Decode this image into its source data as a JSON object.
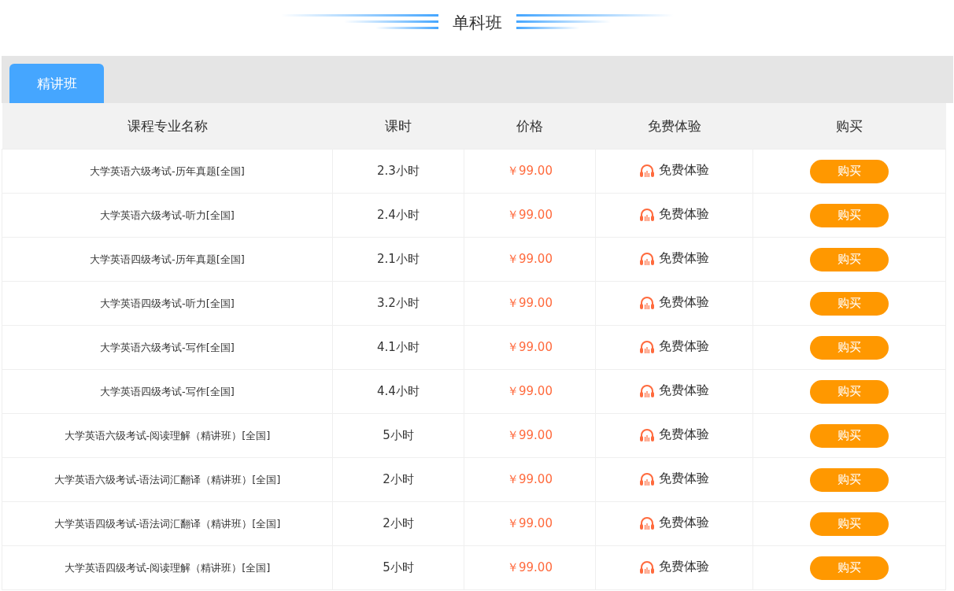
{
  "title": "单科班",
  "tabs": [
    {
      "label": "精讲班",
      "selected": true
    }
  ],
  "table": {
    "columns": [
      "课程专业名称",
      "课时",
      "价格",
      "免费体验",
      "购买"
    ],
    "rows": [
      {
        "name": "大学英语六级考试-历年真题[全国]",
        "hours": "2.3小时",
        "price": "￥99.00",
        "trial": "免费体验",
        "buy": "购买"
      },
      {
        "name": "大学英语六级考试-听力[全国]",
        "hours": "2.4小时",
        "price": "￥99.00",
        "trial": "免费体验",
        "buy": "购买"
      },
      {
        "name": "大学英语四级考试-历年真题[全国]",
        "hours": "2.1小时",
        "price": "￥99.00",
        "trial": "免费体验",
        "buy": "购买"
      },
      {
        "name": "大学英语四级考试-听力[全国]",
        "hours": "3.2小时",
        "price": "￥99.00",
        "trial": "免费体验",
        "buy": "购买"
      },
      {
        "name": "大学英语六级考试-写作[全国]",
        "hours": "4.1小时",
        "price": "￥99.00",
        "trial": "免费体验",
        "buy": "购买"
      },
      {
        "name": "大学英语四级考试-写作[全国]",
        "hours": "4.4小时",
        "price": "￥99.00",
        "trial": "免费体验",
        "buy": "购买"
      },
      {
        "name": "大学英语六级考试-阅读理解（精讲班）[全国]",
        "hours": "5小时",
        "price": "￥99.00",
        "trial": "免费体验",
        "buy": "购买"
      },
      {
        "name": "大学英语六级考试-语法词汇翻译（精讲班）[全国]",
        "hours": "2小时",
        "price": "￥99.00",
        "trial": "免费体验",
        "buy": "购买"
      },
      {
        "name": "大学英语四级考试-语法词汇翻译（精讲班）[全国]",
        "hours": "2小时",
        "price": "￥99.00",
        "trial": "免费体验",
        "buy": "购买"
      },
      {
        "name": "大学英语四级考试-阅读理解（精讲班）[全国]",
        "hours": "5小时",
        "price": "￥99.00",
        "trial": "免费体验",
        "buy": "购买"
      }
    ]
  }
}
